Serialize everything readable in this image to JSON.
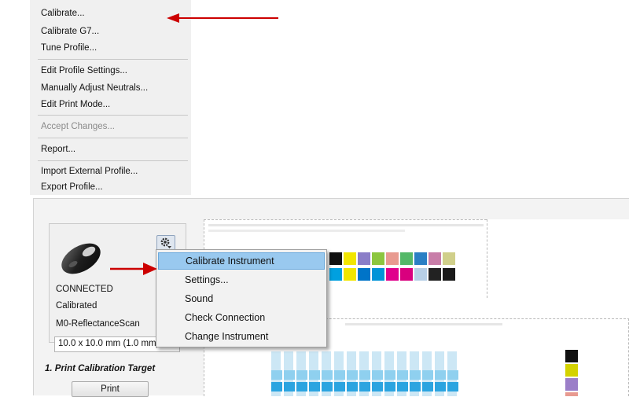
{
  "top_menu": {
    "items": [
      {
        "label": "Calibrate...",
        "enabled": true
      },
      {
        "label": "Calibrate G7...",
        "enabled": true
      },
      {
        "label": "Tune Profile...",
        "enabled": true
      },
      {
        "label": "Edit Profile Settings...",
        "enabled": true
      },
      {
        "label": "Manually Adjust Neutrals...",
        "enabled": true
      },
      {
        "label": "Edit Print Mode...",
        "enabled": true
      },
      {
        "label": "Accept Changes...",
        "enabled": false
      },
      {
        "label": "Report...",
        "enabled": true
      },
      {
        "label": "Import External Profile...",
        "enabled": true
      },
      {
        "label": "Export Profile...",
        "enabled": true
      }
    ]
  },
  "instrument": {
    "status": "CONNECTED",
    "calibration": "Calibrated",
    "mode": "M0-ReflectanceScan",
    "aperture": "10.0 x 10.0 mm (1.0 mm)",
    "settings_icon": "gear-icon"
  },
  "context_menu": {
    "items": [
      {
        "label": "Calibrate Instrument",
        "highlighted": true
      },
      {
        "label": "Settings...",
        "highlighted": false
      },
      {
        "label": "Sound",
        "highlighted": false
      },
      {
        "label": "Check Connection",
        "highlighted": false
      },
      {
        "label": "Change Instrument",
        "highlighted": false
      }
    ]
  },
  "calibration_step": {
    "title": "1. Print Calibration Target",
    "print_label": "Print"
  },
  "colors": {
    "annotation_arrow": "#cc0000",
    "menu_highlight": "#99c9ef",
    "cyan": "#00a0e0",
    "magenta": "#e0008c",
    "yellow": "#f2e600",
    "black": "#111111"
  }
}
